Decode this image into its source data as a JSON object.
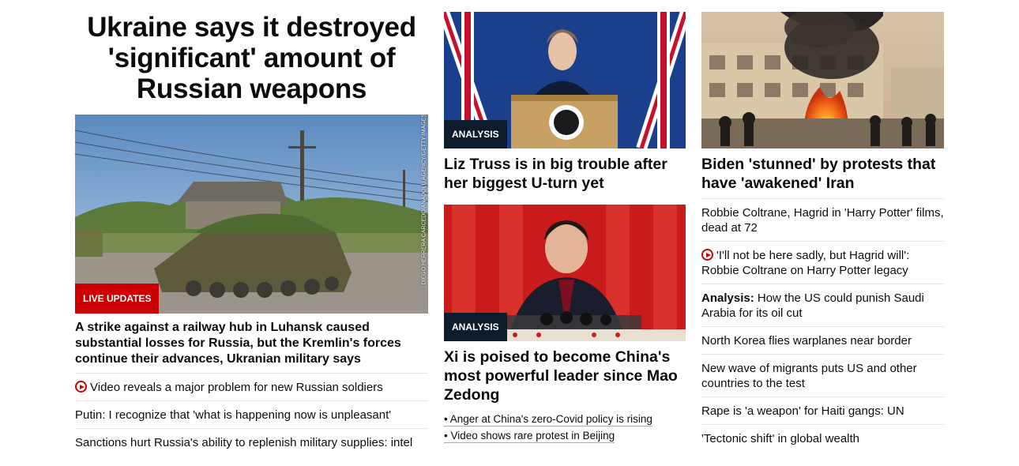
{
  "lead": {
    "title": "Ukraine says it destroyed 'significant' amount of Russian weapons",
    "badge": "LIVE UPDATES",
    "photo_credit": "DIEGO HERRERA CARCEDO/ANADOLU AGENCY/GETTY IMAGES",
    "headline": "A strike against a railway hub in Luhansk caused substantial losses for Russia, but the Kremlin's forces continue their advances, Ukranian military says",
    "links": [
      {
        "text": "Video reveals a major problem for new Russian soldiers",
        "icon": "play-icon"
      },
      {
        "text": "Putin: I recognize that 'what is happening now is unpleasant'"
      },
      {
        "text": "Sanctions hurt Russia's ability to replenish military supplies: intel"
      }
    ]
  },
  "middle": {
    "story1": {
      "badge": "ANALYSIS",
      "headline": "Liz Truss is in big trouble after her biggest U-turn yet"
    },
    "story2": {
      "badge": "ANALYSIS",
      "headline": "Xi is poised to become China's most powerful leader since Mao Zedong",
      "bullets": [
        "• Anger at China's zero-Covid policy is rising",
        "• Video shows rare protest in Beijing"
      ]
    }
  },
  "right": {
    "headline": "Biden 'stunned' by protests that have 'awakened' Iran",
    "links": [
      {
        "text": "Robbie Coltrane, Hagrid in 'Harry Potter' films, dead at 72"
      },
      {
        "text": "'I'll not be here sadly, but Hagrid will': Robbie Coltrane on Harry Potter legacy",
        "icon": "play-icon"
      },
      {
        "prefix": "Analysis:",
        "text": " How the US could punish Saudi Arabia for its oil cut"
      },
      {
        "text": "North Korea flies warplanes near border"
      },
      {
        "text": "New wave of migrants puts US and other countries to the test"
      },
      {
        "text": "Rape is 'a weapon' for Haiti gangs: UN"
      },
      {
        "text": "'Tectonic shift' in global wealth"
      }
    ]
  },
  "colors": {
    "brand_red": "#cc0000",
    "analysis_navy": "#0c1c2c",
    "text": "#0c0c0c",
    "divider": "#e6e6e6"
  }
}
